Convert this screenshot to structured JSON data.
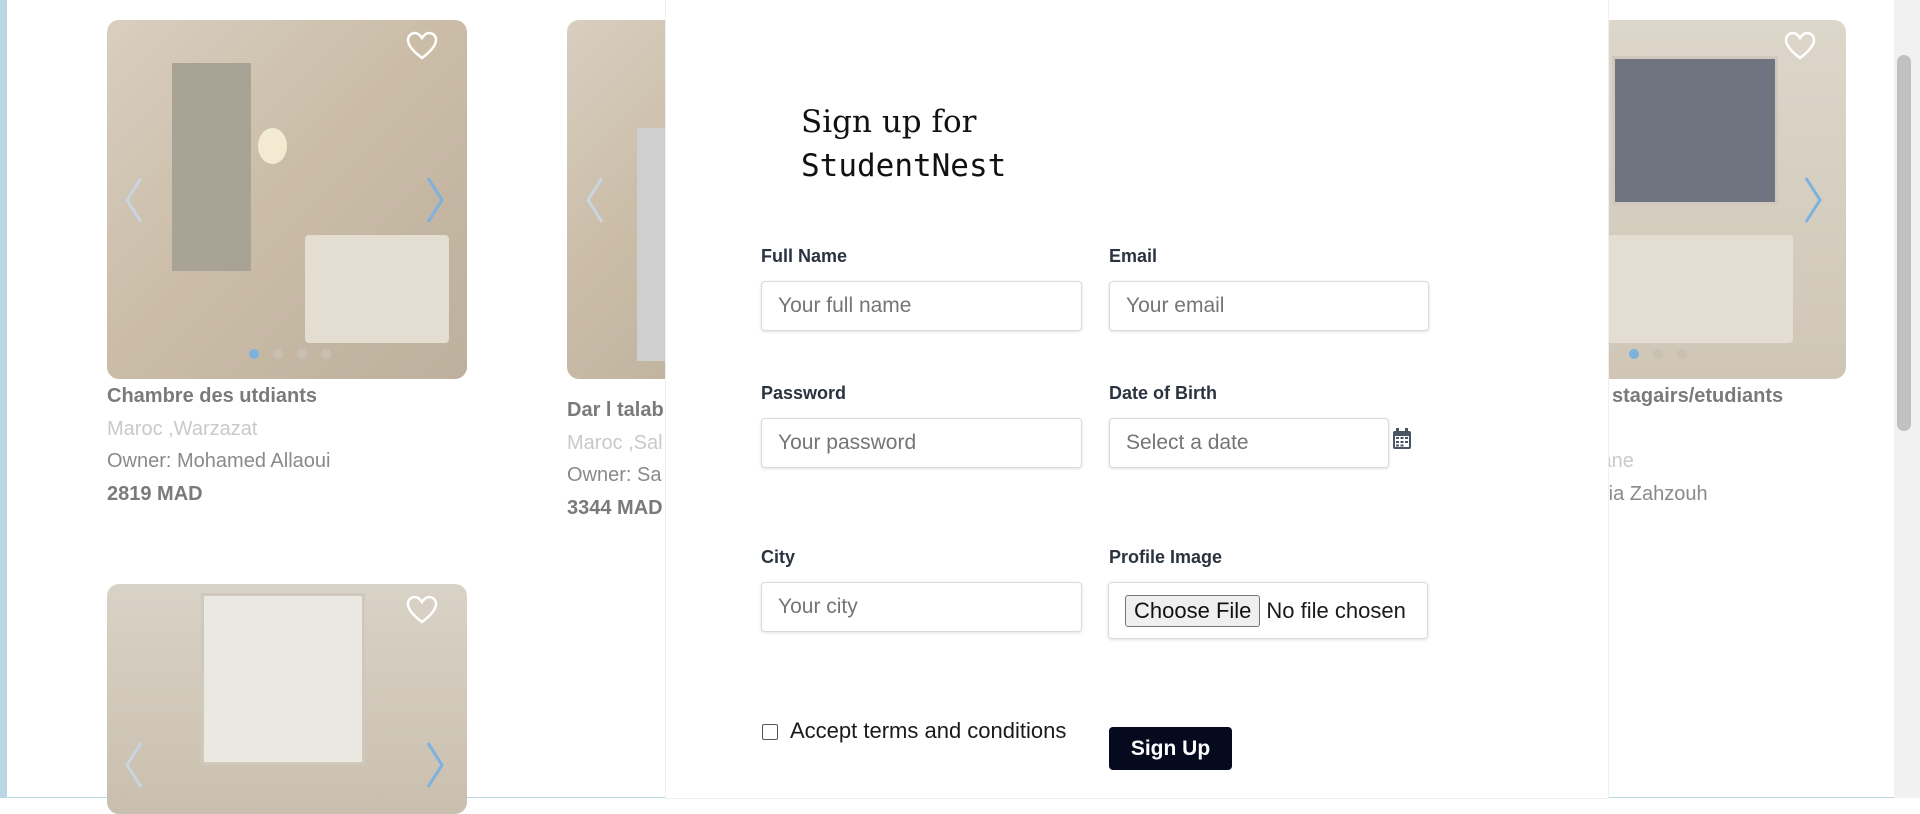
{
  "listings": [
    {
      "title": "Chambre des utdiants",
      "location": "Maroc ,Warzazat",
      "owner": "Owner: Mohamed Allaoui",
      "price": "2819 MAD"
    },
    {
      "title": "Dar l talab",
      "location": "Maroc ,Sal",
      "owner": "Owner: Sa",
      "price": "3344 MAD"
    },
    {
      "title": "stagairs/etudiants",
      "location": "iane",
      "owner": "ria Zahzouh",
      "price": ""
    },
    {
      "title": "",
      "location": "",
      "owner": "",
      "price": ""
    }
  ],
  "modal": {
    "title_prefix": "Sign up for",
    "brand": "StudentNest",
    "fields": {
      "full_name": {
        "label": "Full Name",
        "placeholder": "Your full name"
      },
      "email": {
        "label": "Email",
        "placeholder": "Your email"
      },
      "password": {
        "label": "Password",
        "placeholder": "Your password"
      },
      "dob": {
        "label": "Date of Birth",
        "placeholder": "Select a date"
      },
      "city": {
        "label": "City",
        "placeholder": "Your city"
      },
      "profile_image": {
        "label": "Profile Image",
        "button": "Choose File",
        "status": "No file chosen"
      }
    },
    "terms_label": "Accept terms and conditions",
    "submit_label": "Sign Up"
  },
  "colors": {
    "accent_dot": "#7cb1e0",
    "arrow": "#7cb1e0",
    "submit_bg": "#050a1e"
  },
  "icons": [
    "heart-icon",
    "chevron-left-icon",
    "chevron-right-icon",
    "calendar-icon"
  ]
}
